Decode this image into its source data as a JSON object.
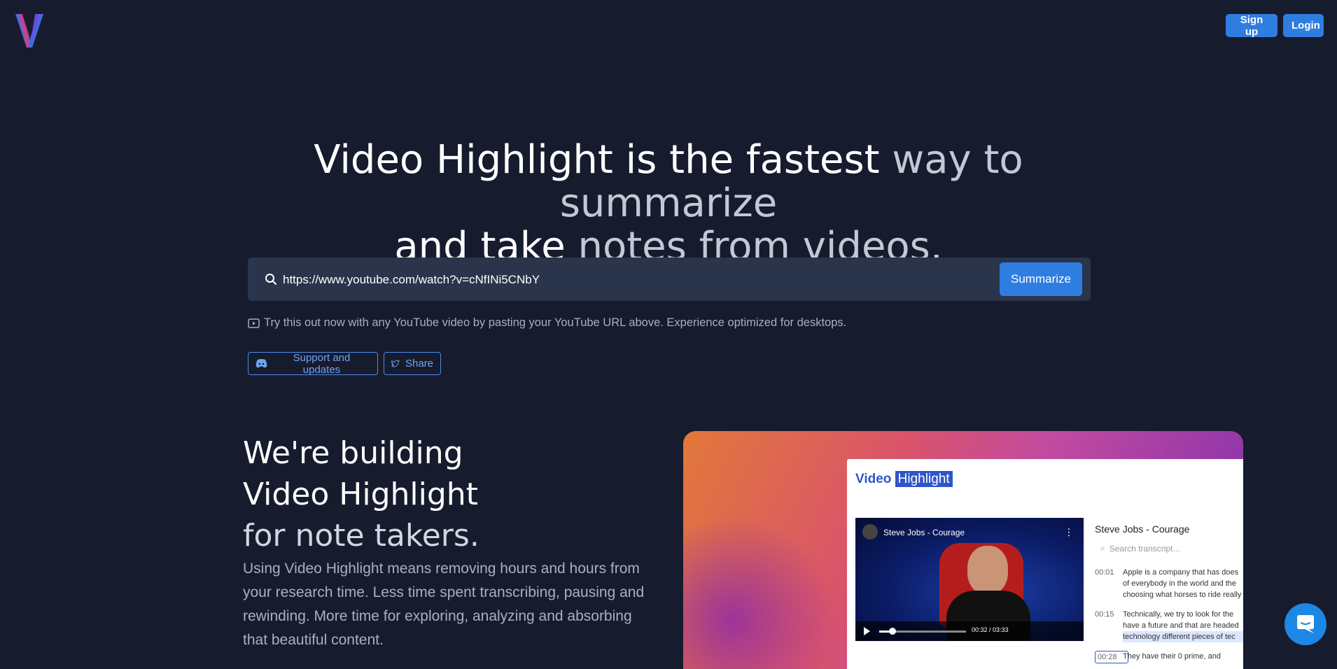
{
  "header": {
    "signup_label": "Sign up",
    "login_label": "Login"
  },
  "hero": {
    "title_part1": "Video Highlight is the fastest",
    "title_part2": " way to summarize",
    "title_part3": "and take",
    "title_part4": " notes from videos."
  },
  "search": {
    "value": "https://www.youtube.com/watch?v=cNfINi5CNbY",
    "button_label": "Summarize",
    "hint": "Try this out now with any YouTube video by pasting your YouTube URL above. Experience optimized for desktops."
  },
  "links": {
    "support_label": "Support and updates",
    "share_label": "Share"
  },
  "section": {
    "title_line1": "We're building",
    "title_line2": "Video Highlight",
    "title_line3": "for note takers.",
    "description": "Using Video Highlight means removing hours and hours from your research time. Less time spent transcribing, pausing and rewinding. More time for exploring, analyzing and absorbing that beautiful content."
  },
  "preview": {
    "logo_part1": "Video",
    "logo_part2": "Highlight",
    "video_title": "Steve Jobs - Courage",
    "video_time": "00:32 / 03:33",
    "video_progress": 0.15,
    "transcript_title": "Steve Jobs - Courage",
    "transcript_search_placeholder": "Search transcript...",
    "rows": [
      {
        "time": "00:01",
        "lines": [
          "Apple is a company that has does",
          "of everybody in the world and the",
          "choosing what horses to ride really"
        ]
      },
      {
        "time": "00:15",
        "lines": [
          "Technically, we try to look for the",
          "have a future and that are headed",
          "technology different pieces of tec"
        ]
      },
      {
        "time": "00:28",
        "lines": [
          "They have their 0 prime, and"
        ]
      }
    ]
  },
  "colors": {
    "background": "#171b2e",
    "accent": "#2f7de1",
    "search_bg": "#2a344b"
  }
}
